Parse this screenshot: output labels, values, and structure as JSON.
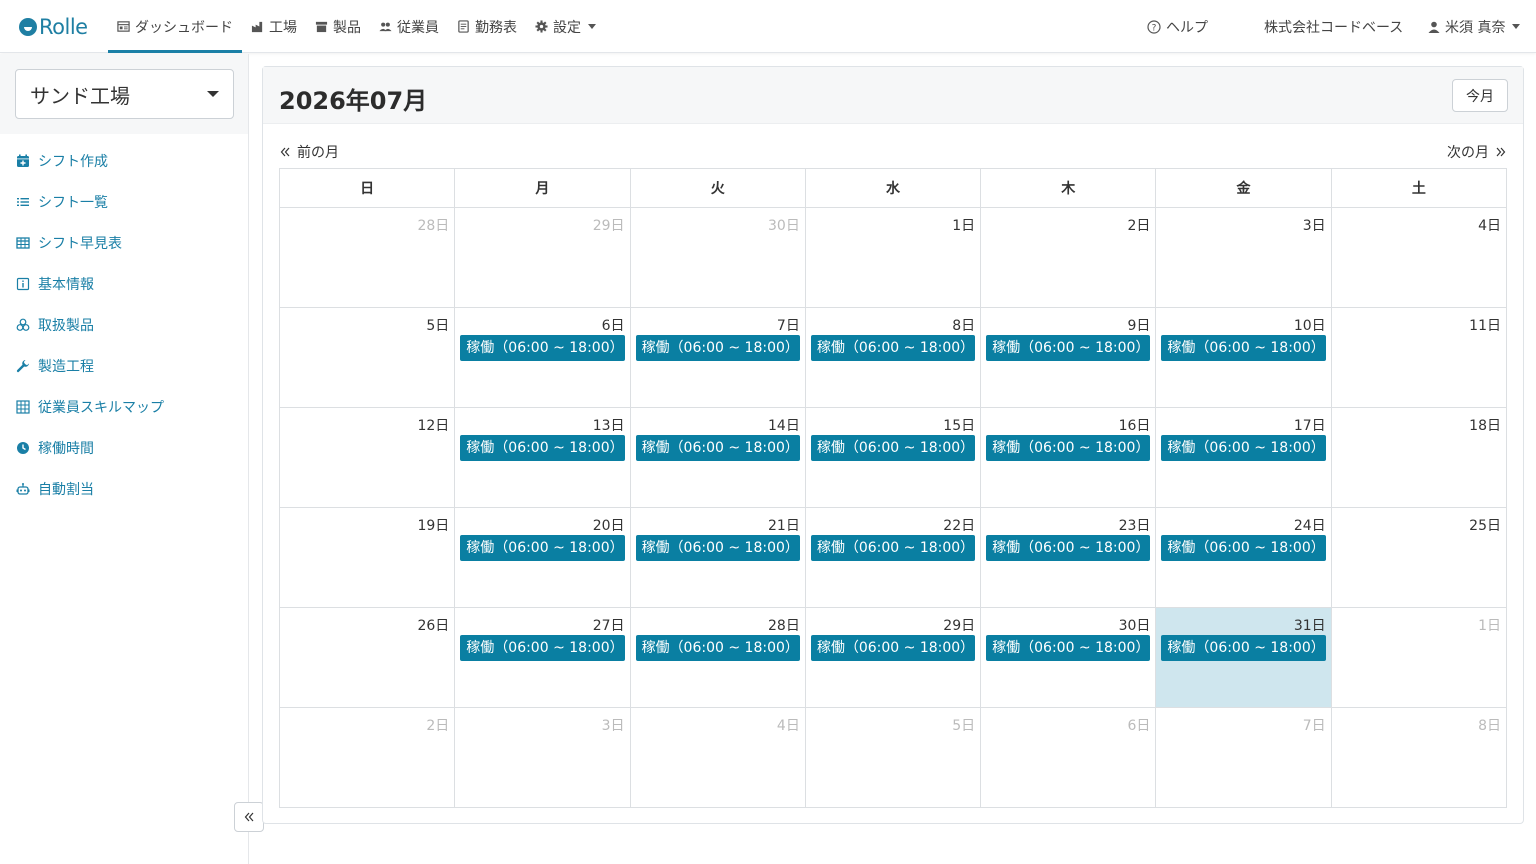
{
  "brand": {
    "name": "Rolle"
  },
  "nav": {
    "items": [
      {
        "label": "ダッシュボード",
        "icon": "dashboard-icon",
        "active": true
      },
      {
        "label": "工場",
        "icon": "factory-icon"
      },
      {
        "label": "製品",
        "icon": "box-icon"
      },
      {
        "label": "従業員",
        "icon": "users-icon"
      },
      {
        "label": "勤務表",
        "icon": "document-icon"
      },
      {
        "label": "設定",
        "icon": "gear-icon",
        "dropdown": true
      }
    ],
    "help": "ヘルプ",
    "company": "株式会社コードベース",
    "user": "米須 真奈"
  },
  "sidebar": {
    "factory": "サンド工場",
    "items": [
      {
        "label": "シフト作成",
        "icon": "calendar-plus-icon"
      },
      {
        "label": "シフト一覧",
        "icon": "list-icon"
      },
      {
        "label": "シフト早見表",
        "icon": "table-icon"
      },
      {
        "label": "基本情報",
        "icon": "info-icon"
      },
      {
        "label": "取扱製品",
        "icon": "cubes-icon"
      },
      {
        "label": "製造工程",
        "icon": "wrench-icon"
      },
      {
        "label": "従業員スキルマップ",
        "icon": "grid-icon"
      },
      {
        "label": "稼働時間",
        "icon": "clock-icon"
      },
      {
        "label": "自動割当",
        "icon": "robot-icon"
      }
    ]
  },
  "calendar": {
    "title": "2026年07月",
    "today_button": "今月",
    "prev_label": "前の月",
    "next_label": "次の月",
    "weekdays": [
      "日",
      "月",
      "火",
      "水",
      "木",
      "金",
      "土"
    ],
    "weeks": [
      [
        {
          "d": "28日",
          "other": true
        },
        {
          "d": "29日",
          "other": true
        },
        {
          "d": "30日",
          "other": true
        },
        {
          "d": "1日"
        },
        {
          "d": "2日"
        },
        {
          "d": "3日"
        },
        {
          "d": "4日"
        }
      ],
      [
        {
          "d": "5日"
        },
        {
          "d": "6日",
          "ev": "稼働（06:00 ~ 18:00）"
        },
        {
          "d": "7日",
          "ev": "稼働（06:00 ~ 18:00）"
        },
        {
          "d": "8日",
          "ev": "稼働（06:00 ~ 18:00）"
        },
        {
          "d": "9日",
          "ev": "稼働（06:00 ~ 18:00）"
        },
        {
          "d": "10日",
          "ev": "稼働（06:00 ~ 18:00）"
        },
        {
          "d": "11日"
        }
      ],
      [
        {
          "d": "12日"
        },
        {
          "d": "13日",
          "ev": "稼働（06:00 ~ 18:00）"
        },
        {
          "d": "14日",
          "ev": "稼働（06:00 ~ 18:00）"
        },
        {
          "d": "15日",
          "ev": "稼働（06:00 ~ 18:00）"
        },
        {
          "d": "16日",
          "ev": "稼働（06:00 ~ 18:00）"
        },
        {
          "d": "17日",
          "ev": "稼働（06:00 ~ 18:00）"
        },
        {
          "d": "18日"
        }
      ],
      [
        {
          "d": "19日"
        },
        {
          "d": "20日",
          "ev": "稼働（06:00 ~ 18:00）"
        },
        {
          "d": "21日",
          "ev": "稼働（06:00 ~ 18:00）"
        },
        {
          "d": "22日",
          "ev": "稼働（06:00 ~ 18:00）"
        },
        {
          "d": "23日",
          "ev": "稼働（06:00 ~ 18:00）"
        },
        {
          "d": "24日",
          "ev": "稼働（06:00 ~ 18:00）"
        },
        {
          "d": "25日"
        }
      ],
      [
        {
          "d": "26日"
        },
        {
          "d": "27日",
          "ev": "稼働（06:00 ~ 18:00）"
        },
        {
          "d": "28日",
          "ev": "稼働（06:00 ~ 18:00）"
        },
        {
          "d": "29日",
          "ev": "稼働（06:00 ~ 18:00）"
        },
        {
          "d": "30日",
          "ev": "稼働（06:00 ~ 18:00）"
        },
        {
          "d": "31日",
          "ev": "稼働（06:00 ~ 18:00）",
          "today": true
        },
        {
          "d": "1日",
          "other": true
        }
      ],
      [
        {
          "d": "2日",
          "other": true
        },
        {
          "d": "3日",
          "other": true
        },
        {
          "d": "4日",
          "other": true
        },
        {
          "d": "5日",
          "other": true
        },
        {
          "d": "6日",
          "other": true
        },
        {
          "d": "7日",
          "other": true
        },
        {
          "d": "8日",
          "other": true
        }
      ]
    ]
  }
}
